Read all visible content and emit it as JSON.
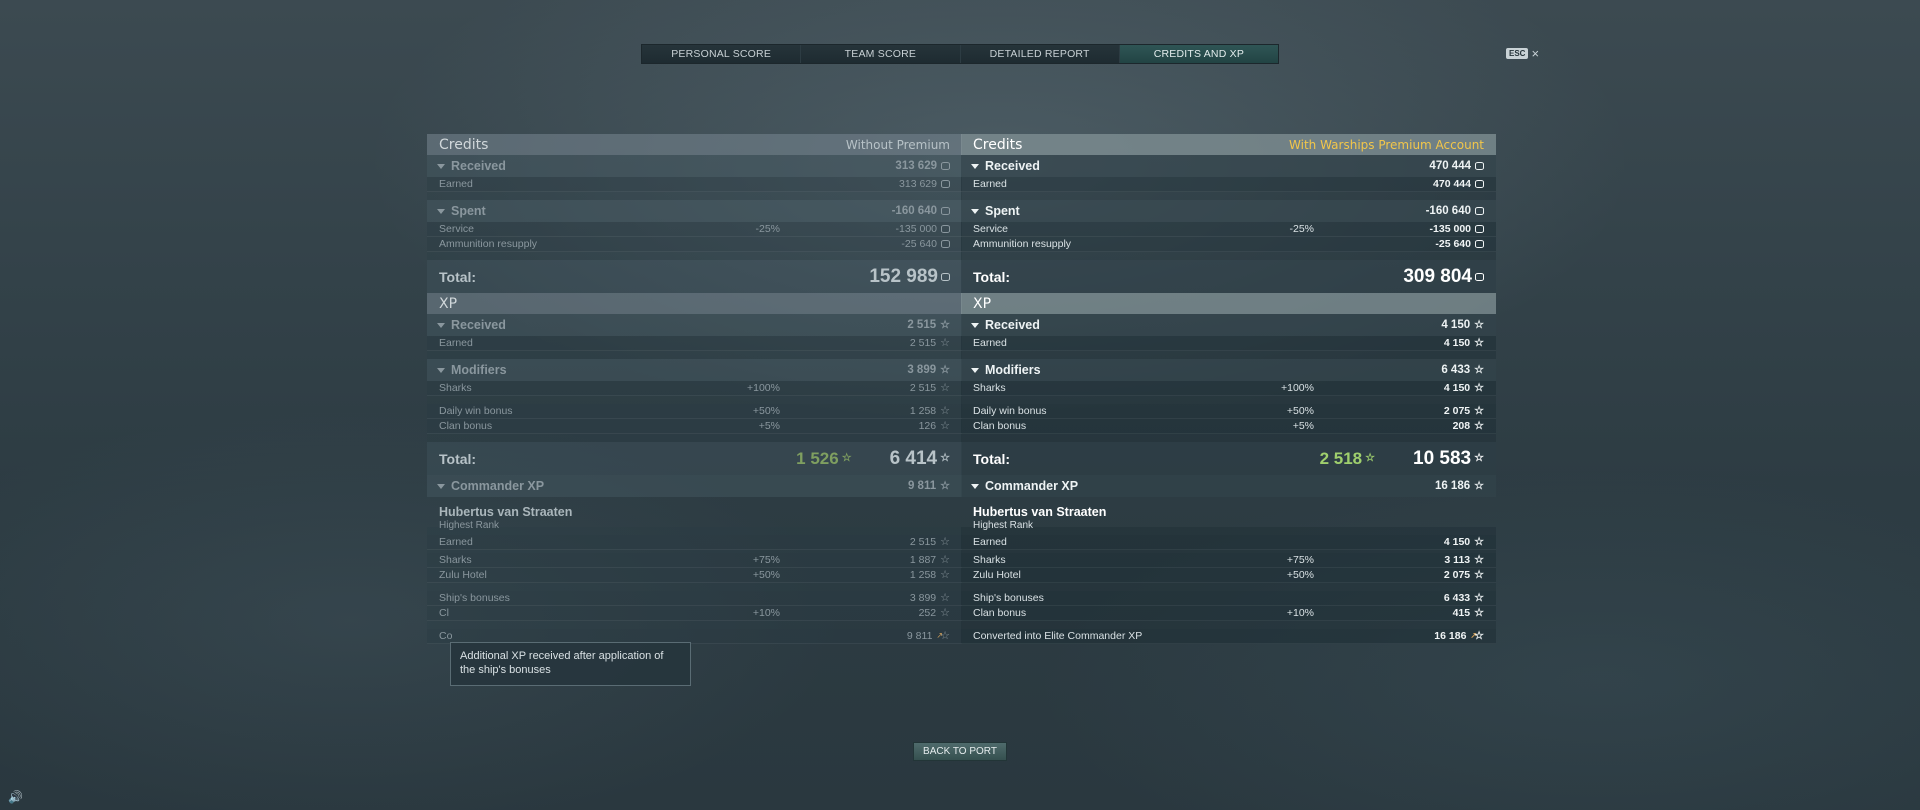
{
  "tabs": [
    "PERSONAL SCORE",
    "TEAM SCORE",
    "DETAILED REPORT",
    "CREDITS AND XP"
  ],
  "active_tab": 3,
  "esc_label": "ESC",
  "close_glyph": "×",
  "left": {
    "credits_title": "Credits",
    "credits_note": "Without Premium",
    "received_label": "Received",
    "received_value": "313 629",
    "earned_label": "Earned",
    "earned_value": "313 629",
    "spent_label": "Spent",
    "spent_value": "-160 640",
    "service_label": "Service",
    "service_pct": "-25%",
    "service_value": "-135 000",
    "ammo_label": "Ammunition resupply",
    "ammo_value": "-25 640",
    "total_label": "Total:",
    "credits_total": "152 989",
    "xp_title": "XP",
    "xp_received_label": "Received",
    "xp_received_value": "2 515",
    "xp_earned_label": "Earned",
    "xp_earned_value": "2 515",
    "modifiers_label": "Modifiers",
    "modifiers_value": "3 899",
    "sharks_label": "Sharks",
    "sharks_pct": "+100%",
    "sharks_value": "2 515",
    "daily_label": "Daily win bonus",
    "daily_pct": "+50%",
    "daily_value": "1 258",
    "clan_label": "Clan bonus",
    "clan_pct": "+5%",
    "clan_value": "126",
    "xp_total_green": "1 526",
    "xp_total": "6 414",
    "cmd_label": "Commander XP",
    "cmd_value": "9 811",
    "cmd_name": "Hubertus van Straaten",
    "cmd_rank": "Highest Rank",
    "c_earned_label": "Earned",
    "c_earned_value": "2 515",
    "c_sharks_label": "Sharks",
    "c_sharks_pct": "+75%",
    "c_sharks_value": "1 887",
    "c_zulu_label": "Zulu Hotel",
    "c_zulu_pct": "+50%",
    "c_zulu_value": "1 258",
    "c_ship_label": "Ship's bonuses",
    "c_ship_value": "3 899",
    "c_clan_label": "Cl",
    "c_clan_pct": "+10%",
    "c_clan_value": "252",
    "c_conv_label": "Co",
    "c_conv_value": "9 811"
  },
  "right": {
    "credits_title": "Credits",
    "credits_note": "With Warships Premium Account",
    "received_label": "Received",
    "received_value": "470 444",
    "earned_label": "Earned",
    "earned_value": "470 444",
    "spent_label": "Spent",
    "spent_value": "-160 640",
    "service_label": "Service",
    "service_pct": "-25%",
    "service_value": "-135 000",
    "ammo_label": "Ammunition resupply",
    "ammo_value": "-25 640",
    "total_label": "Total:",
    "credits_total": "309 804",
    "xp_title": "XP",
    "xp_received_label": "Received",
    "xp_received_value": "4 150",
    "xp_earned_label": "Earned",
    "xp_earned_value": "4 150",
    "modifiers_label": "Modifiers",
    "modifiers_value": "6 433",
    "sharks_label": "Sharks",
    "sharks_pct": "+100%",
    "sharks_value": "4 150",
    "daily_label": "Daily win bonus",
    "daily_pct": "+50%",
    "daily_value": "2 075",
    "clan_label": "Clan bonus",
    "clan_pct": "+5%",
    "clan_value": "208",
    "xp_total_green": "2 518",
    "xp_total": "10 583",
    "cmd_label": "Commander XP",
    "cmd_value": "16 186",
    "cmd_name": "Hubertus van Straaten",
    "cmd_rank": "Highest Rank",
    "c_earned_label": "Earned",
    "c_earned_value": "4 150",
    "c_sharks_label": "Sharks",
    "c_sharks_pct": "+75%",
    "c_sharks_value": "3 113",
    "c_zulu_label": "Zulu Hotel",
    "c_zulu_pct": "+50%",
    "c_zulu_value": "2 075",
    "c_ship_label": "Ship's bonuses",
    "c_ship_value": "6 433",
    "c_clan_label": "Clan bonus",
    "c_clan_pct": "+10%",
    "c_clan_value": "415",
    "c_conv_label": "Converted into Elite Commander XP",
    "c_conv_value": "16 186"
  },
  "tooltip_text": "Additional XP received after application of the ship's bonuses",
  "back_button": "BACK TO PORT",
  "icons": {
    "credit": "credit-icon",
    "xp": "star-icon",
    "elite_xp": "elite-xp-icon",
    "sound": "speaker-icon"
  },
  "colors": {
    "premium_note": "#f2c64a",
    "green_total": "#9fcf6d",
    "active_tab": "#2f5555"
  }
}
